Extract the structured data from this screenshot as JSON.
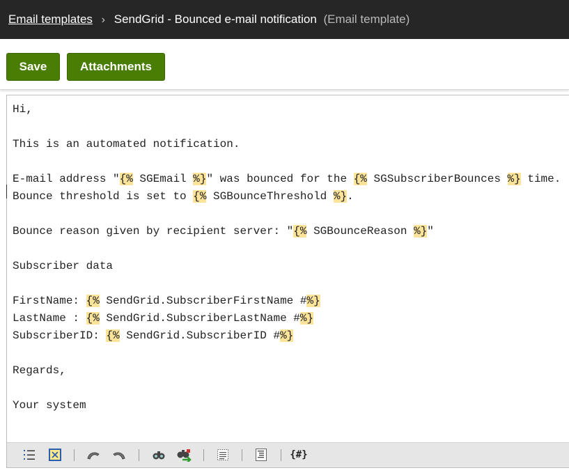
{
  "header": {
    "breadcrumb_link": "Email templates",
    "separator": "›",
    "current": "SendGrid - Bounced e-mail notification",
    "type_label": "(Email template)"
  },
  "toolbar": {
    "save_label": "Save",
    "attachments_label": "Attachments"
  },
  "editor": {
    "lines": [
      [
        {
          "t": "Hi,"
        }
      ],
      [],
      [
        {
          "t": "This is an automated notification."
        }
      ],
      [],
      [
        {
          "t": "E-mail address \""
        },
        {
          "t": "{%",
          "h": 1
        },
        {
          "t": " SGEmail "
        },
        {
          "t": "%}",
          "h": 1
        },
        {
          "t": "\" was bounced for the "
        },
        {
          "t": "{%",
          "h": 1
        },
        {
          "t": " SGSubscriberBounces "
        },
        {
          "t": "%}",
          "h": 1
        },
        {
          "t": " time."
        }
      ],
      [
        {
          "t": "Bounce threshold is set to "
        },
        {
          "t": "{%",
          "h": 1
        },
        {
          "t": " SGBounceThreshold "
        },
        {
          "t": "%}",
          "h": 1
        },
        {
          "t": "."
        }
      ],
      [],
      [
        {
          "t": "Bounce reason given by recipient server: \""
        },
        {
          "t": "{%",
          "h": 1
        },
        {
          "t": " SGBounceReason "
        },
        {
          "t": "%}",
          "h": 1
        },
        {
          "t": "\""
        }
      ],
      [],
      [
        {
          "t": "Subscriber data"
        }
      ],
      [],
      [
        {
          "t": "FirstName: "
        },
        {
          "t": "{%",
          "h": 1
        },
        {
          "t": " SendGrid.SubscriberFirstName #"
        },
        {
          "t": "%}",
          "h": 1
        }
      ],
      [
        {
          "t": "LastName : "
        },
        {
          "t": "{%",
          "h": 1
        },
        {
          "t": " SendGrid.SubscriberLastName #"
        },
        {
          "t": "%}",
          "h": 1
        }
      ],
      [
        {
          "t": "SubscriberID: "
        },
        {
          "t": "{%",
          "h": 1
        },
        {
          "t": " SendGrid.SubscriberID #"
        },
        {
          "t": "%}",
          "h": 1
        }
      ],
      [],
      [
        {
          "t": "Regards,"
        }
      ],
      [],
      [
        {
          "t": "Your system"
        }
      ]
    ],
    "toolbar_icons": [
      "numbered-list-icon",
      "fullscreen-icon",
      "undo-icon",
      "redo-icon",
      "find-icon",
      "find-replace-icon",
      "select-all-icon",
      "format-code-icon",
      "insert-macro-icon"
    ],
    "macro_icon_text": "{#}"
  }
}
